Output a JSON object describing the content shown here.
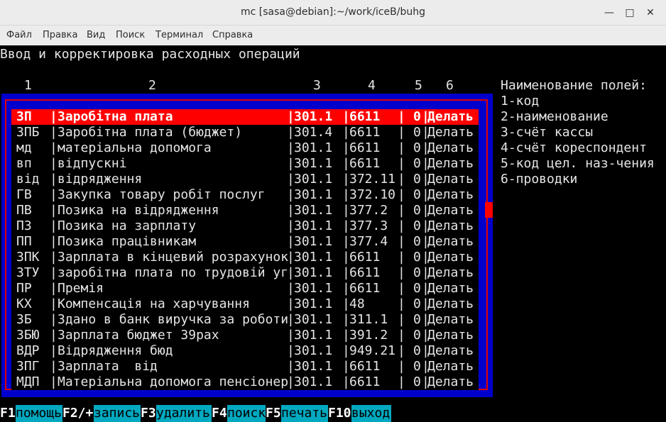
{
  "window": {
    "title": "mc [sasa@debian]:~/work/iceB/buhg",
    "minimize_icon": "minimize-icon",
    "maximize_icon": "maximize-icon",
    "close_icon": "close-icon"
  },
  "menu": [
    "Файл",
    "Правка",
    "Вид",
    "Поиск",
    "Терминал",
    "Справка"
  ],
  "screen": {
    "heading": "Ввод и корректировка расходных операций",
    "columns": [
      "1",
      "2",
      "3",
      "4",
      "5",
      "6"
    ],
    "legend": {
      "title": "Наименование полей:",
      "items": [
        "1-код",
        "2-наименование",
        "3-счёт кассы",
        "4-счёт кореспондент",
        "5-код цел. наз-чения",
        "6-проводки"
      ]
    }
  },
  "table": {
    "selected_index": 0,
    "rows": [
      [
        "ЗП",
        "Заробітна плата",
        "301.1",
        "6611",
        "0",
        "Делать"
      ],
      [
        "ЗПБ",
        "Заробітна плата (бюджет)",
        "301.4",
        "6611",
        "0",
        "Делать"
      ],
      [
        "мд",
        "матеріальна допомога",
        "301.1",
        "6611",
        "0",
        "Делать"
      ],
      [
        "вп",
        "відпускні",
        "301.1",
        "6611",
        "0",
        "Делать"
      ],
      [
        "від",
        "відрядження",
        "301.1",
        "372.11",
        "0",
        "Делать"
      ],
      [
        "ГВ",
        "Закупка товару робіт послуг",
        "301.1",
        "372.10",
        "0",
        "Делать"
      ],
      [
        "ПВ",
        "Позика на відрядження",
        "301.1",
        "377.2",
        "0",
        "Делать"
      ],
      [
        "ПЗ",
        "Позика на зарплату",
        "301.1",
        "377.3",
        "0",
        "Делать"
      ],
      [
        "ПП",
        "Позика працівникам",
        "301.1",
        "377.4",
        "0",
        "Делать"
      ],
      [
        "ЗПК",
        "Зарплата в кінцевий розрахунок",
        "301.1",
        "6611",
        "0",
        "Делать"
      ],
      [
        "ЗТУ",
        "заробітна плата по трудовій уг",
        "301.1",
        "6611",
        "0",
        "Делать"
      ],
      [
        "ПР",
        "Премія",
        "301.1",
        "6611",
        "0",
        "Делать"
      ],
      [
        "КХ",
        "Компенсація на харчування",
        "301.1",
        "48",
        "0",
        "Делать"
      ],
      [
        "ЗБ",
        "Здано в банк виручка за роботи",
        "301.1",
        "311.1",
        "0",
        "Делать"
      ],
      [
        "ЗБЮ",
        "Зарплата бюджет 39рах",
        "301.1",
        "391.2",
        "0",
        "Делать"
      ],
      [
        "ВДР",
        "Відрядження бюд",
        "301.1",
        "949.21",
        "0",
        "Делать"
      ],
      [
        "ЗПГ",
        "Зарплата  від",
        "301.1",
        "6611",
        "0",
        "Делать"
      ],
      [
        "МДП",
        "Матеріальна допомога пенсіонер",
        "301.1",
        "6611",
        "0",
        "Делать"
      ]
    ]
  },
  "fkeys": [
    {
      "key": "F1",
      "label": "помощь"
    },
    {
      "key": "F2/+",
      "label": "запись"
    },
    {
      "key": "F3",
      "label": "удалить"
    },
    {
      "key": "F4",
      "label": "поиск"
    },
    {
      "key": "F5",
      "label": "печать"
    },
    {
      "key": "F10",
      "label": "выход"
    }
  ]
}
